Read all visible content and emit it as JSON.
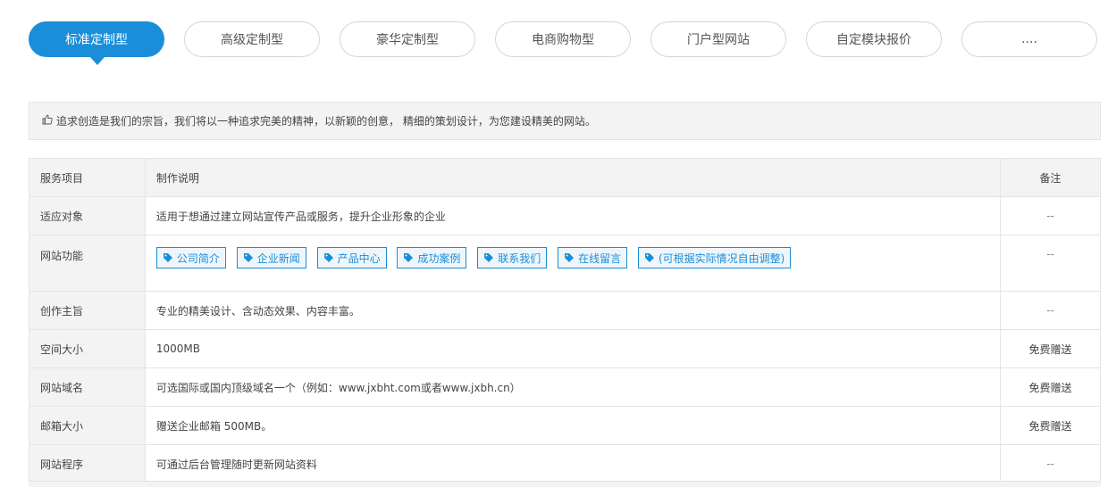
{
  "tabs": [
    {
      "label": "标准定制型",
      "active": true
    },
    {
      "label": "高级定制型",
      "active": false
    },
    {
      "label": "豪华定制型",
      "active": false
    },
    {
      "label": "电商购物型",
      "active": false
    },
    {
      "label": "门户型网站",
      "active": false
    },
    {
      "label": "自定模块报价",
      "active": false
    },
    {
      "label": "....",
      "active": false
    }
  ],
  "notice": {
    "icon": "thumbs-up-icon",
    "text": "追求创造是我们的宗旨，我们将以一种追求完美的精神，以新颖的创意， 精细的策划设计，为您建设精美的网站。"
  },
  "table": {
    "header": {
      "col1": "服务项目",
      "col2": "制作说明",
      "col3": "备注"
    },
    "rows": [
      {
        "item": "适应对象",
        "desc": "适用于想通过建立网站宣传产品或服务，提升企业形象的企业",
        "note": "--"
      },
      {
        "item": "网站功能",
        "note": "--",
        "tags": [
          "公司简介",
          "企业新闻",
          "产品中心",
          "成功案例",
          "联系我们",
          "在线留言",
          "(可根据实际情况自由调整)"
        ]
      },
      {
        "item": "创作主旨",
        "desc": "专业的精美设计、含动态效果、内容丰富。",
        "note": "--"
      },
      {
        "item": "空间大小",
        "desc": "1000MB",
        "note": "免费赠送"
      },
      {
        "item": "网站域名",
        "desc": "可选国际或国内顶级域名一个（例如：www.jxbht.com或者www.jxbh.cn）",
        "note": "免费赠送"
      },
      {
        "item": "邮箱大小",
        "desc": "赠送企业邮箱 500MB。",
        "note": "免费赠送"
      },
      {
        "item": "网站程序",
        "desc": "可通过后台管理随时更新网站资料",
        "note": "--"
      }
    ]
  },
  "colors": {
    "accent": "#1a8ed8",
    "row_header_bg": "#f3f3f3",
    "border": "#e4e4e4"
  }
}
